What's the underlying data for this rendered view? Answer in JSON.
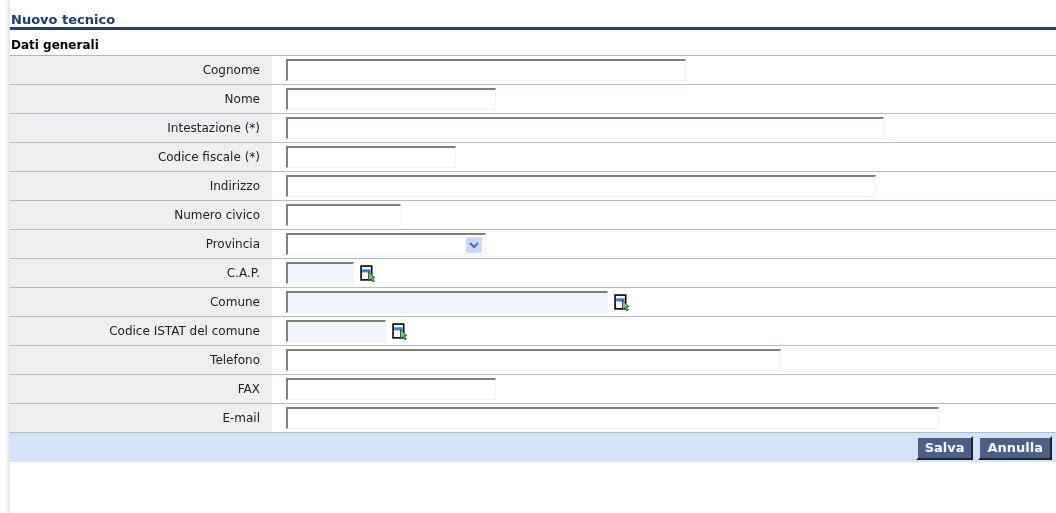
{
  "title": "Nuovo tecnico",
  "section": "Dati generali",
  "fields": [
    {
      "label": "Cognome",
      "kind": "text"
    },
    {
      "label": "Nome",
      "kind": "text"
    },
    {
      "label": "Intestazione (*)",
      "kind": "text"
    },
    {
      "label": "Codice fiscale (*)",
      "kind": "text"
    },
    {
      "label": "Indirizzo",
      "kind": "text"
    },
    {
      "label": "Numero civico",
      "kind": "text"
    },
    {
      "label": "Provincia",
      "kind": "select"
    },
    {
      "label": "C.A.P.",
      "kind": "lookup"
    },
    {
      "label": "Comune",
      "kind": "lookup"
    },
    {
      "label": "Codice ISTAT del comune",
      "kind": "lookup"
    },
    {
      "label": "Telefono",
      "kind": "text"
    },
    {
      "label": "FAX",
      "kind": "text"
    },
    {
      "label": "E-mail",
      "kind": "text"
    }
  ],
  "buttons": [
    "Salva",
    "Annulla"
  ]
}
